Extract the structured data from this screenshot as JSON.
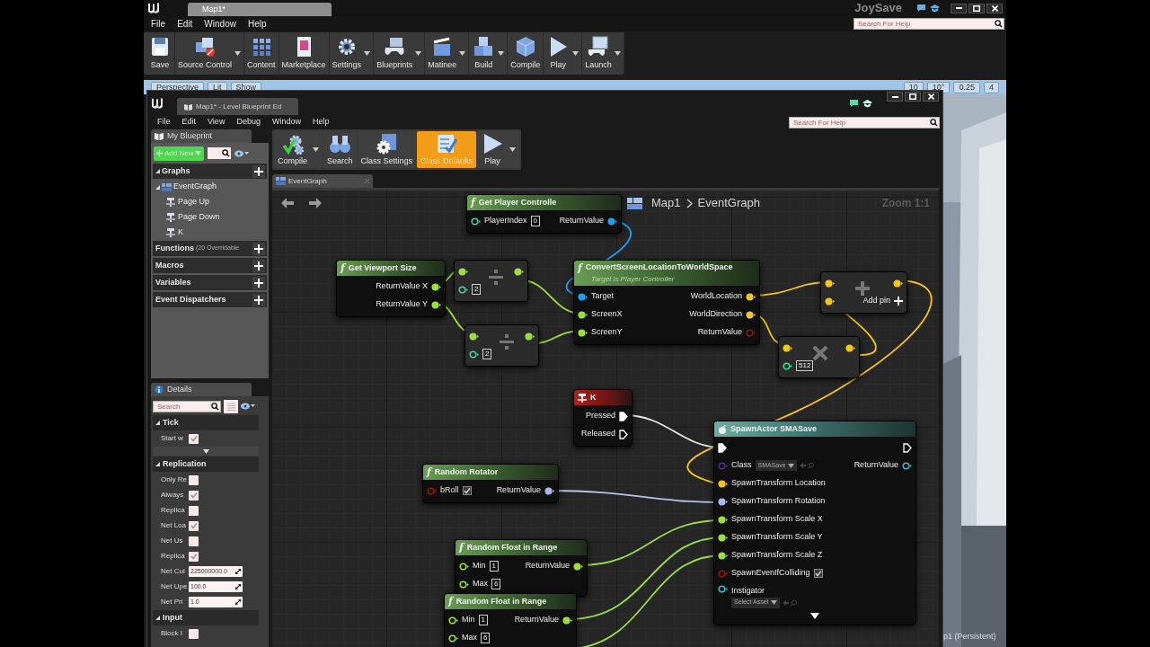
{
  "main_tab": "Map1*",
  "app_title": "JoySave",
  "help_search": {
    "placeholder": "Search For Help"
  },
  "menu": [
    "File",
    "Edit",
    "Window",
    "Help"
  ],
  "toolbar": [
    {
      "label": "Save",
      "dropdown": false
    },
    {
      "label": "Source Control",
      "dropdown": true
    },
    {
      "label": "Content",
      "dropdown": false
    },
    {
      "label": "Marketplace",
      "dropdown": false
    },
    {
      "label": "Settings",
      "dropdown": true
    },
    {
      "label": "Blueprints",
      "dropdown": true
    },
    {
      "label": "Matinee",
      "dropdown": true
    },
    {
      "label": "Build",
      "dropdown": true
    },
    {
      "label": "Compile",
      "dropdown": false
    },
    {
      "label": "Play",
      "dropdown": true
    },
    {
      "label": "Launch",
      "dropdown": true
    }
  ],
  "viewport_toolbar": [
    "Perspective",
    "Lit",
    "Show",
    "10",
    "10°",
    "0.25",
    "4"
  ],
  "level_label": "p1 (Persistent)",
  "blueprint_editor": {
    "tab": "Map1* - Level Blueprint Ed",
    "menu": [
      "File",
      "Edit",
      "View",
      "Debug",
      "Window",
      "Help"
    ],
    "help_search": {
      "placeholder": "Search For Help"
    },
    "my_blueprint": {
      "tab": "My Blueprint",
      "add_new": "Add New",
      "sections": [
        {
          "label": "Graphs",
          "children": [
            {
              "label": "EventGraph",
              "expanded": true,
              "children": [
                {
                  "label": "Page Up"
                },
                {
                  "label": "Page Down"
                },
                {
                  "label": "K"
                }
              ]
            }
          ]
        },
        {
          "label": "Functions",
          "note": "(20 Overridable"
        },
        {
          "label": "Macros"
        },
        {
          "label": "Variables"
        },
        {
          "label": "Event Dispatchers"
        }
      ]
    },
    "details": {
      "tab": "Details",
      "search": {
        "placeholder": "Search"
      },
      "sections": [
        {
          "label": "Tick",
          "rows": [
            {
              "label": "Start w",
              "kind": "checkbox",
              "checked": true
            }
          ]
        },
        {
          "label": "Replication",
          "rows": [
            {
              "label": "Only Re",
              "kind": "checkbox",
              "checked": false
            },
            {
              "label": "Always",
              "kind": "checkbox",
              "checked": true
            },
            {
              "label": "Replica",
              "kind": "checkbox",
              "checked": false
            },
            {
              "label": "Net Loa",
              "kind": "checkbox",
              "checked": true
            },
            {
              "label": "Net Us",
              "kind": "checkbox",
              "checked": false
            },
            {
              "label": "Replica",
              "kind": "checkbox",
              "checked": true
            },
            {
              "label": "Net Cul",
              "kind": "number",
              "value": "225000000.0"
            },
            {
              "label": "Net Upe",
              "kind": "number",
              "value": "100.0"
            },
            {
              "label": "Net Pri",
              "kind": "number",
              "value": "1.0"
            }
          ]
        },
        {
          "label": "Input",
          "rows": [
            {
              "label": "Block I",
              "kind": "checkbox",
              "checked": false
            }
          ]
        }
      ]
    },
    "toolbar": [
      {
        "label": "Compile",
        "dropdown": true,
        "selected": false
      },
      {
        "label": "Search",
        "dropdown": false,
        "selected": false
      },
      {
        "label": "Class Settings",
        "dropdown": false,
        "selected": false
      },
      {
        "label": "Class Defaults",
        "dropdown": false,
        "selected": true
      },
      {
        "label": "Play",
        "dropdown": true,
        "selected": false
      }
    ],
    "graph": {
      "tab": "EventGraph",
      "breadcrumb": [
        "Map1",
        "EventGraph"
      ],
      "zoom": "Zoom 1:1",
      "nodes": [
        {
          "kind": "function",
          "glyph": "f",
          "title": "Get Player Controlle",
          "inputs": [
            {
              "label": "PlayerIndex",
              "color": "#33dd99",
              "connected": false,
              "value": "0"
            }
          ],
          "outputs": [
            {
              "label": "ReturnValue",
              "color": "#1ea0f0",
              "connected": true
            }
          ]
        },
        {
          "kind": "function",
          "glyph": "f",
          "title": "Get Viewport Size",
          "outputs": [
            {
              "label": "ReturnValue X",
              "color": "#9be03a",
              "connected": true
            },
            {
              "label": "ReturnValue Y",
              "color": "#9be03a",
              "connected": true
            }
          ]
        },
        {
          "kind": "divide",
          "inputs": [
            {
              "color": "#9be03a",
              "connected": true
            },
            {
              "color": "#33dd99",
              "connected": false,
              "value": "2"
            }
          ],
          "outputs": [
            {
              "color": "#9be03a",
              "connected": true
            }
          ]
        },
        {
          "kind": "divide",
          "inputs": [
            {
              "color": "#9be03a",
              "connected": true
            },
            {
              "color": "#33dd99",
              "connected": false,
              "value": "2"
            }
          ],
          "outputs": [
            {
              "color": "#9be03a",
              "connected": true
            }
          ]
        },
        {
          "kind": "function",
          "glyph": "f",
          "title": "ConvertScreenLocationToWorldSpace",
          "subtitle": "Target is Player Controller",
          "inputs": [
            {
              "label": "Target",
              "color": "#1ea0f0",
              "connected": true
            },
            {
              "label": "ScreenX",
              "color": "#9be03a",
              "connected": true
            },
            {
              "label": "ScreenY",
              "color": "#9be03a",
              "connected": true
            }
          ],
          "outputs": [
            {
              "label": "WorldLocation",
              "color": "#f5c518",
              "connected": true
            },
            {
              "label": "WorldDirection",
              "color": "#f5c518",
              "connected": true
            },
            {
              "label": "ReturnValue",
              "color": "#a01010",
              "connected": false
            }
          ]
        },
        {
          "kind": "add",
          "add_pin": "Add pin",
          "inputs": [
            {
              "color": "#f5c518",
              "connected": true
            },
            {
              "color": "#f5c518",
              "connected": true
            }
          ],
          "outputs": [
            {
              "color": "#f5c518",
              "connected": true
            }
          ]
        },
        {
          "kind": "multiply",
          "inputs": [
            {
              "color": "#f5c518",
              "connected": true
            },
            {
              "color": "#33dd99",
              "connected": false,
              "value": "512"
            }
          ],
          "outputs": [
            {
              "color": "#f5c518",
              "connected": true
            }
          ]
        },
        {
          "kind": "event",
          "title": "K",
          "outputs": [
            {
              "kind": "exec",
              "label": "Pressed",
              "connected": true
            },
            {
              "kind": "exec",
              "label": "Released",
              "connected": false
            }
          ]
        },
        {
          "kind": "function",
          "glyph": "f",
          "title": "Random Rotator",
          "inputs": [
            {
              "label": "bRoll",
              "color": "#a01010",
              "connected": false,
              "checked": true
            }
          ],
          "outputs": [
            {
              "label": "ReturnValue",
              "color": "#a8b8f0",
              "connected": true
            }
          ]
        },
        {
          "kind": "spawn",
          "title": "SpawnActor SMASave",
          "inputs": [
            {
              "kind": "exec",
              "connected": true
            },
            {
              "label": "Class",
              "color": "#4a2a90",
              "connected": false,
              "select": "SMASave"
            },
            {
              "label": "SpawnTransform Location",
              "color": "#f5c518",
              "connected": true
            },
            {
              "label": "SpawnTransform Rotation",
              "color": "#a8b8f0",
              "connected": true
            },
            {
              "label": "SpawnTransform Scale X",
              "color": "#9be03a",
              "connected": true
            },
            {
              "label": "SpawnTransform Scale Y",
              "color": "#9be03a",
              "connected": true
            },
            {
              "label": "SpawnTransform Scale Z",
              "color": "#9be03a",
              "connected": true
            },
            {
              "label": "SpawnEvenIfColliding",
              "color": "#a01010",
              "connected": false,
              "checked": true
            },
            {
              "label": "Instigator",
              "color": "#3bb8c8",
              "connected": false,
              "select": "Select Asset"
            }
          ],
          "outputs": [
            {
              "kind": "exec",
              "connected": false
            },
            {
              "label": "ReturnValue",
              "color": "#3bb8c8",
              "connected": false
            }
          ]
        },
        {
          "kind": "function",
          "glyph": "f",
          "title": "Random Float in Range",
          "inputs": [
            {
              "label": "Min",
              "color": "#9be03a",
              "connected": false,
              "value": "1"
            },
            {
              "label": "Max",
              "color": "#9be03a",
              "connected": false,
              "value": "6"
            }
          ],
          "outputs": [
            {
              "label": "ReturnValue",
              "color": "#9be03a",
              "connected": true
            }
          ]
        },
        {
          "kind": "function",
          "glyph": "f",
          "title": "Random Float in Range",
          "inputs": [
            {
              "label": "Min",
              "color": "#9be03a",
              "connected": false,
              "value": "1"
            },
            {
              "label": "Max",
              "color": "#9be03a",
              "connected": false,
              "value": "6"
            }
          ],
          "outputs": [
            {
              "label": "ReturnValue",
              "color": "#9be03a",
              "connected": true
            }
          ]
        }
      ]
    }
  }
}
